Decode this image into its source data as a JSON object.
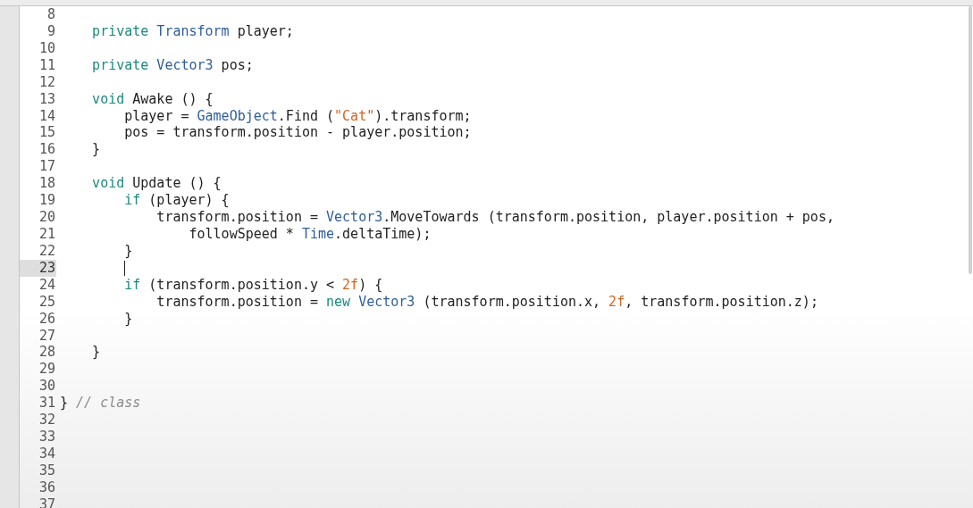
{
  "editor": {
    "lines": [
      {
        "number": "8",
        "current": false
      },
      {
        "number": "9",
        "current": false,
        "tokens": [
          {
            "kind": "keyword",
            "text": "    private"
          },
          {
            "kind": "type",
            "text": " Transform"
          },
          {
            "kind": "plain",
            "text": " player;"
          }
        ]
      },
      {
        "number": "10",
        "current": false
      },
      {
        "number": "11",
        "current": false,
        "tokens": [
          {
            "kind": "keyword",
            "text": "    private"
          },
          {
            "kind": "type",
            "text": " Vector3"
          },
          {
            "kind": "plain",
            "text": " pos;"
          }
        ]
      },
      {
        "number": "12",
        "current": false
      },
      {
        "number": "13",
        "current": false,
        "tokens": [
          {
            "kind": "keyword",
            "text": "    void"
          },
          {
            "kind": "plain",
            "text": " Awake () {"
          }
        ]
      },
      {
        "number": "14",
        "current": false,
        "tokens": [
          {
            "kind": "plain",
            "text": "        player = "
          },
          {
            "kind": "type",
            "text": "GameObject"
          },
          {
            "kind": "plain",
            "text": ".Find ("
          },
          {
            "kind": "string",
            "text": "\"Cat\""
          },
          {
            "kind": "plain",
            "text": ").transform;"
          }
        ]
      },
      {
        "number": "15",
        "current": false,
        "tokens": [
          {
            "kind": "plain",
            "text": "        pos = transform.position - player.position;"
          }
        ]
      },
      {
        "number": "16",
        "current": false,
        "tokens": [
          {
            "kind": "plain",
            "text": "    }"
          }
        ]
      },
      {
        "number": "17",
        "current": false
      },
      {
        "number": "18",
        "current": false,
        "tokens": [
          {
            "kind": "keyword",
            "text": "    void"
          },
          {
            "kind": "plain",
            "text": " Update () {"
          }
        ]
      },
      {
        "number": "19",
        "current": false,
        "tokens": [
          {
            "kind": "keyword",
            "text": "        if"
          },
          {
            "kind": "plain",
            "text": " (player) {"
          }
        ]
      },
      {
        "number": "20",
        "current": false,
        "tokens": [
          {
            "kind": "plain",
            "text": "            transform.position = "
          },
          {
            "kind": "type",
            "text": "Vector3"
          },
          {
            "kind": "plain",
            "text": ".MoveTowards (transform.position, player.position + pos,"
          }
        ]
      },
      {
        "number": "21",
        "current": false,
        "tokens": [
          {
            "kind": "plain",
            "text": "                followSpeed * "
          },
          {
            "kind": "type",
            "text": "Time"
          },
          {
            "kind": "plain",
            "text": ".deltaTime);"
          }
        ]
      },
      {
        "number": "22",
        "current": false,
        "tokens": [
          {
            "kind": "plain",
            "text": "        }"
          }
        ]
      },
      {
        "number": "23",
        "current": true
      },
      {
        "number": "24",
        "current": false,
        "tokens": [
          {
            "kind": "keyword",
            "text": "        if"
          },
          {
            "kind": "plain",
            "text": " (transform.position.y < "
          },
          {
            "kind": "string",
            "text": "2f"
          },
          {
            "kind": "plain",
            "text": ") {"
          }
        ]
      },
      {
        "number": "25",
        "current": false,
        "tokens": [
          {
            "kind": "plain",
            "text": "            transform.position = "
          },
          {
            "kind": "keyword",
            "text": "new"
          },
          {
            "kind": "type",
            "text": " Vector3"
          },
          {
            "kind": "plain",
            "text": " (transform.position.x, "
          },
          {
            "kind": "string",
            "text": "2f"
          },
          {
            "kind": "plain",
            "text": ", transform.position.z);"
          }
        ]
      },
      {
        "number": "26",
        "current": false,
        "tokens": [
          {
            "kind": "plain",
            "text": "        }"
          }
        ]
      },
      {
        "number": "27",
        "current": false
      },
      {
        "number": "28",
        "current": false,
        "tokens": [
          {
            "kind": "plain",
            "text": "    }"
          }
        ]
      },
      {
        "number": "29",
        "current": false
      },
      {
        "number": "30",
        "current": false
      },
      {
        "number": "31",
        "current": false,
        "tokens": [
          {
            "kind": "plain",
            "text": "} "
          },
          {
            "kind": "comment",
            "text": "// class"
          }
        ]
      },
      {
        "number": "32",
        "current": false
      },
      {
        "number": "33",
        "current": false
      },
      {
        "number": "34",
        "current": false
      },
      {
        "number": "35",
        "current": false
      },
      {
        "number": "36",
        "current": false
      },
      {
        "number": "37",
        "current": false
      }
    ]
  }
}
